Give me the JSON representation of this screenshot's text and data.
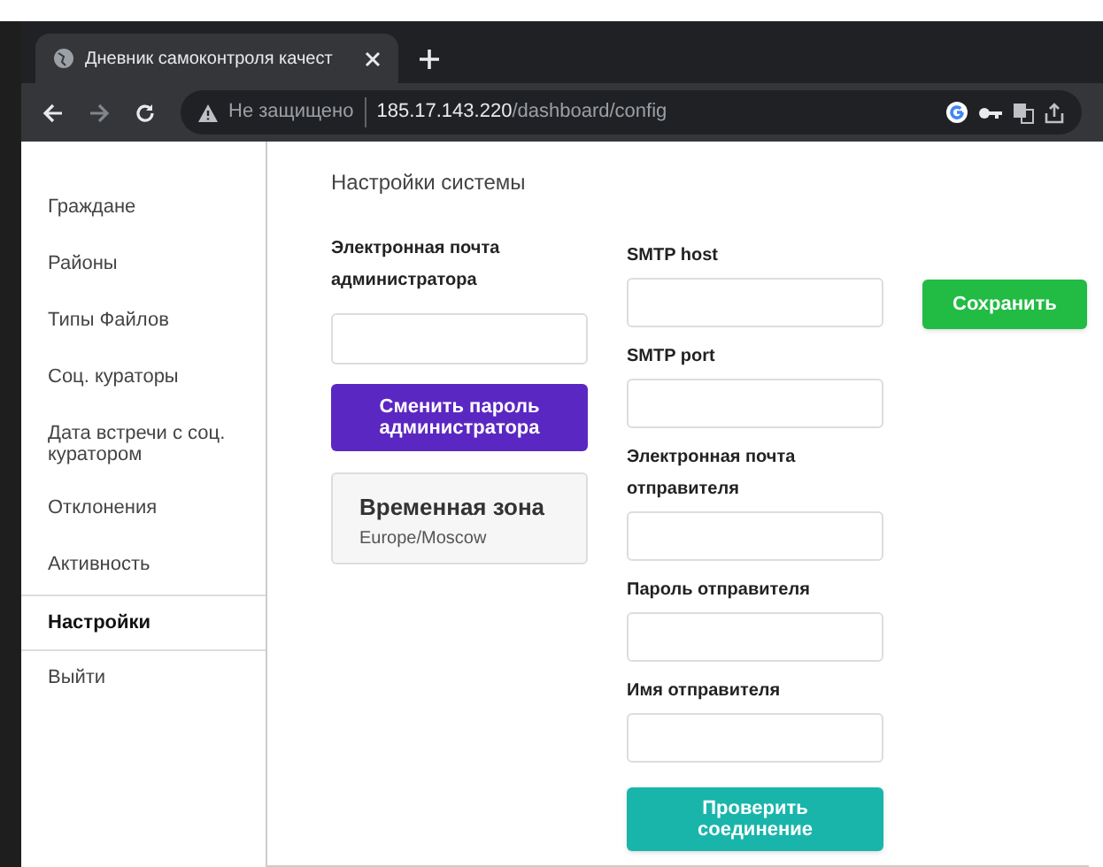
{
  "browser": {
    "tab_title": "Дневник самоконтроля качест",
    "security": "Не защищено",
    "url_host": "185.17.143.220",
    "url_path": "/dashboard/config"
  },
  "sidebar": {
    "items": [
      {
        "label": "Граждане",
        "selected": false
      },
      {
        "label": "Районы",
        "selected": false
      },
      {
        "label": "Типы Файлов",
        "selected": false
      },
      {
        "label": "Соц. кураторы",
        "selected": false
      },
      {
        "label": "Дата встречи с соц. куратором",
        "selected": false
      },
      {
        "label": "Отклонения",
        "selected": false
      },
      {
        "label": "Активность",
        "selected": false
      },
      {
        "label": "Настройки",
        "selected": true
      },
      {
        "label": "Выйти",
        "selected": false
      }
    ]
  },
  "page_title": "Настройки системы",
  "admin": {
    "email_label": "Электронная почта администратора",
    "change_password_button": "Сменить пароль администратора",
    "timezone_title": "Временная зона",
    "timezone_value": "Europe/Moscow"
  },
  "smtp_fields": [
    {
      "label": "SMTP host"
    },
    {
      "label": "SMTP port"
    },
    {
      "label": "Электронная почта отправителя"
    },
    {
      "label": "Пароль отправителя"
    },
    {
      "label": "Имя отправителя"
    }
  ],
  "test_button": "Проверить соединение",
  "save_button": "Сохранить"
}
